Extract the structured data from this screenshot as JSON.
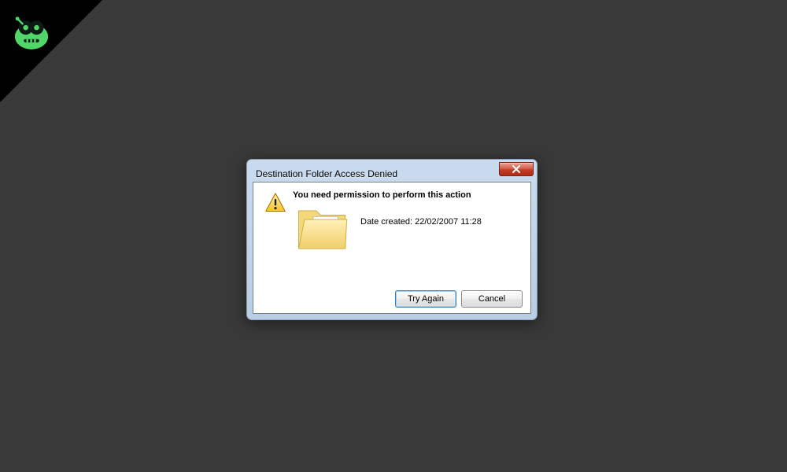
{
  "badge": {
    "icon_name": "robot-icon"
  },
  "dialog": {
    "title": "Destination Folder Access Denied",
    "close_icon_name": "close-icon",
    "message": "You need permission to perform this action",
    "date_label": "Date created: ",
    "date_value": "22/02/2007 11:28",
    "buttons": {
      "try_again": "Try Again",
      "cancel": "Cancel"
    }
  }
}
